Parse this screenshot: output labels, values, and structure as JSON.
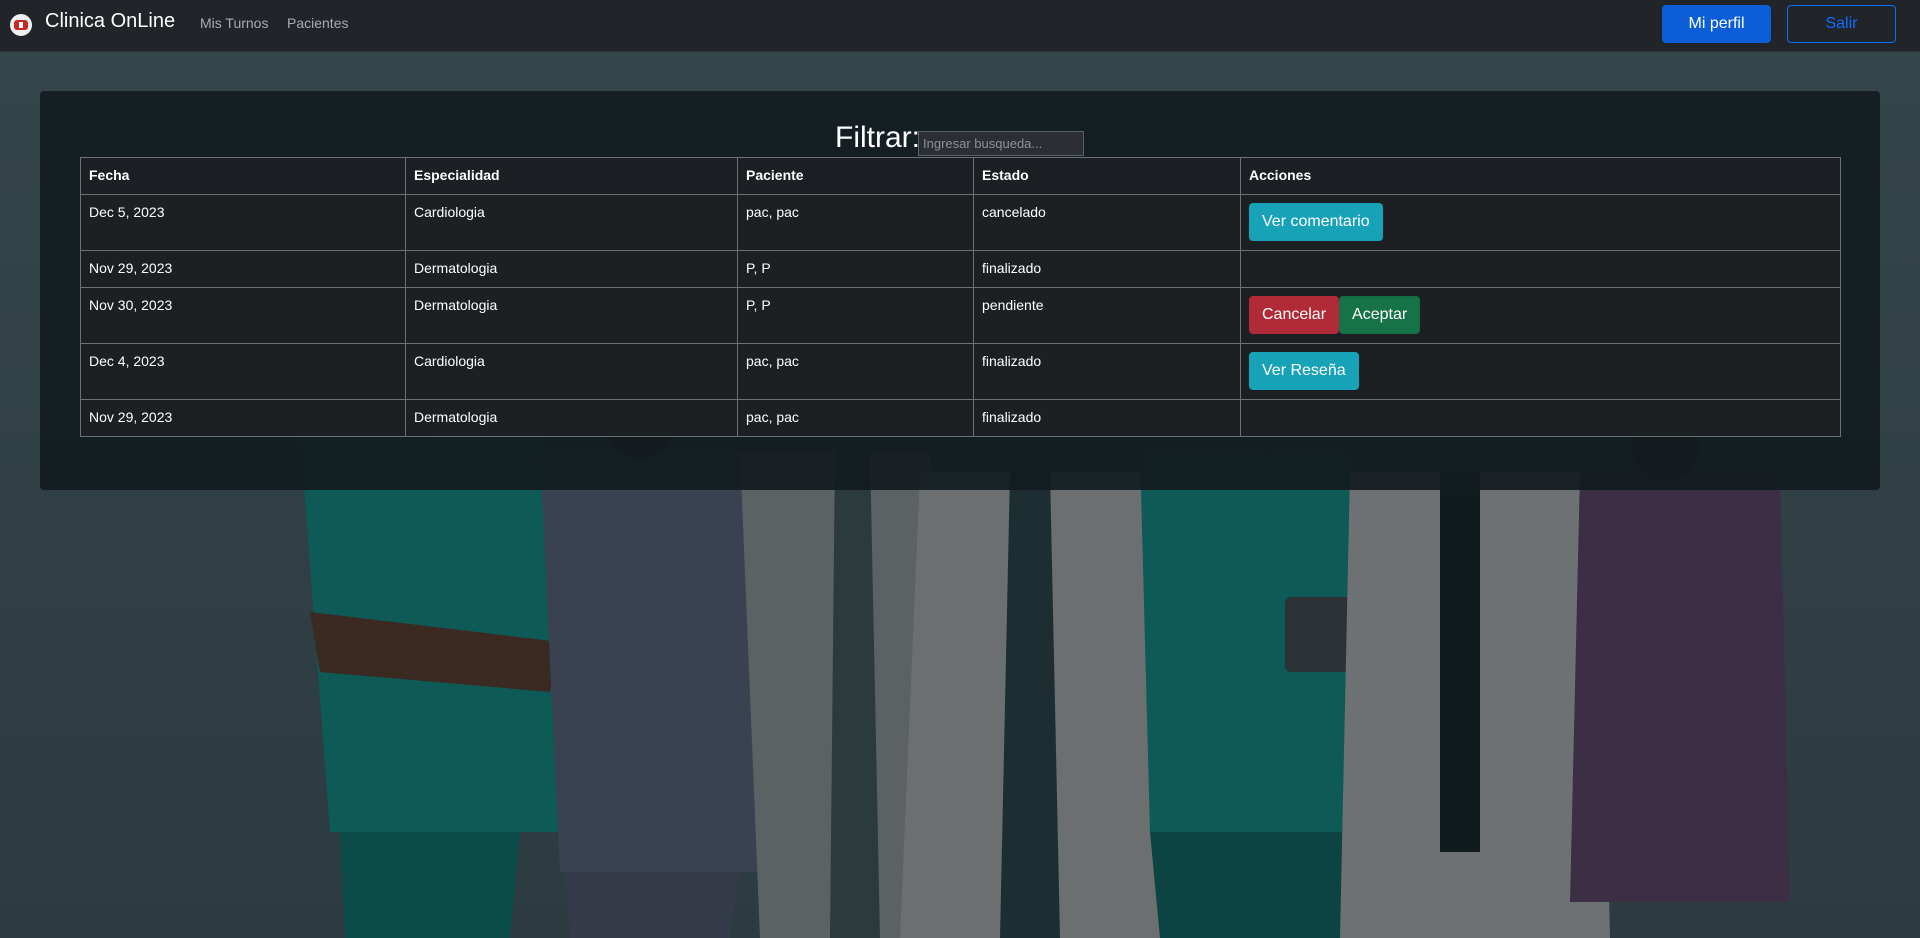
{
  "navbar": {
    "brand": "Clinica OnLine",
    "links": [
      "Mis Turnos",
      "Pacientes"
    ],
    "profile_label": "Mi perfil",
    "logout_label": "Salir"
  },
  "filter": {
    "label": "Filtrar:",
    "placeholder": "Ingresar busqueda..."
  },
  "table": {
    "headers": [
      "Fecha",
      "Especialidad",
      "Paciente",
      "Estado",
      "Acciones"
    ],
    "rows": [
      {
        "fecha": "Dec 5, 2023",
        "especialidad": "Cardiologia",
        "paciente": "pac, pac",
        "estado": "cancelado",
        "actions": [
          "Ver comentario"
        ]
      },
      {
        "fecha": "Nov 29, 2023",
        "especialidad": "Dermatologia",
        "paciente": "P, P",
        "estado": "finalizado",
        "actions": []
      },
      {
        "fecha": "Nov 30, 2023",
        "especialidad": "Dermatologia",
        "paciente": "P, P",
        "estado": "pendiente",
        "actions": [
          "Cancelar",
          "Aceptar"
        ]
      },
      {
        "fecha": "Dec 4, 2023",
        "especialidad": "Cardiologia",
        "paciente": "pac, pac",
        "estado": "finalizado",
        "actions": [
          "Ver Reseña"
        ]
      },
      {
        "fecha": "Nov 29, 2023",
        "especialidad": "Dermatologia",
        "paciente": "pac, pac",
        "estado": "finalizado",
        "actions": []
      }
    ]
  },
  "colors": {
    "primary": "#0b5ed7",
    "info": "#17a2b8",
    "danger": "#b02a37",
    "success": "#157347",
    "navbar_bg": "#212529"
  }
}
